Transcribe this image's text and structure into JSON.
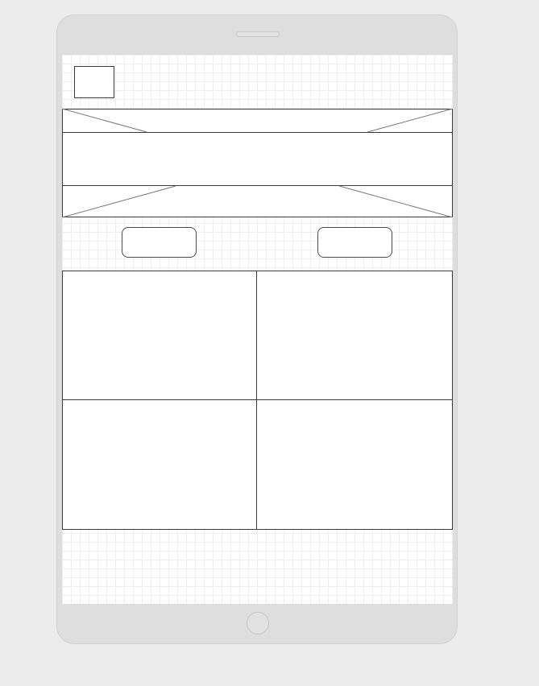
{
  "wireframe": {
    "device": "tablet",
    "logo": {
      "icon": "image-placeholder-icon"
    },
    "banner": {
      "icon": "image-placeholder-icon"
    },
    "buttons": [
      {
        "label": ""
      },
      {
        "label": ""
      }
    ],
    "grid": {
      "rows": 2,
      "columns": 2,
      "cells": [
        "",
        "",
        "",
        ""
      ]
    },
    "colors": {
      "device_frame": "#dedede",
      "background": "#ececec",
      "screen": "#ffffff",
      "outline": "#3a3a3a",
      "grid_line": "#eeeeee"
    }
  }
}
